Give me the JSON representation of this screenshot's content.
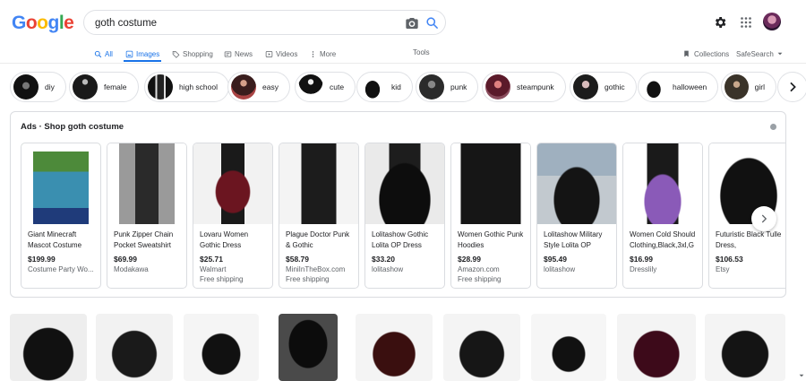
{
  "logo": {
    "letters": [
      "G",
      "o",
      "o",
      "g",
      "l",
      "e"
    ],
    "colors": [
      "#4285f4",
      "#ea4335",
      "#fbbc05",
      "#4285f4",
      "#34a853",
      "#ea4335"
    ]
  },
  "search": {
    "query": "goth costume"
  },
  "tabs": [
    {
      "label": "All",
      "icon": "search-icon"
    },
    {
      "label": "Images",
      "icon": "image-icon",
      "active": true
    },
    {
      "label": "Shopping",
      "icon": "tag-icon"
    },
    {
      "label": "News",
      "icon": "news-icon"
    },
    {
      "label": "Videos",
      "icon": "play-icon"
    },
    {
      "label": "More",
      "icon": "more-icon"
    }
  ],
  "tools_label": "Tools",
  "collections_label": "Collections",
  "safesearch_label": "SafeSearch",
  "chips": [
    "diy",
    "female",
    "high school",
    "easy",
    "cute",
    "kid",
    "punk",
    "steampunk",
    "gothic",
    "halloween",
    "girl"
  ],
  "ads": {
    "title": "Ads · Shop goth costume",
    "products": [
      {
        "name": "Giant Minecraft Mascot Costume",
        "price": "$199.99",
        "store": "Costume Party Wo...",
        "shipping": ""
      },
      {
        "name": "Punk Zipper Chain Pocket Sweatshirt",
        "price": "$69.99",
        "store": "Modakawa",
        "shipping": ""
      },
      {
        "name": "Lovaru Women Gothic Dress",
        "price": "$25.71",
        "store": "Walmart",
        "shipping": "Free shipping"
      },
      {
        "name": "Plague Doctor Punk & Gothic",
        "price": "$58.79",
        "store": "MiniInTheBox.com",
        "shipping": "Free shipping"
      },
      {
        "name": "Lolitashow Gothic Lolita OP Dress",
        "price": "$33.20",
        "store": "lolitashow",
        "shipping": ""
      },
      {
        "name": "Women Gothic Punk Hoodies",
        "price": "$28.99",
        "store": "Amazon.com",
        "shipping": "Free shipping"
      },
      {
        "name": "Lolitashow Military Style Lolita OP",
        "price": "$95.49",
        "store": "lolitashow",
        "shipping": ""
      },
      {
        "name": "Women Cold Should Clothing,Black,3xl,G",
        "price": "$16.99",
        "store": "Dresslily",
        "shipping": ""
      },
      {
        "name": "Futuristic Black Tulle Dress,",
        "price": "$106.53",
        "store": "Etsy",
        "shipping": ""
      }
    ]
  },
  "colors": {
    "accent": "#1a73e8",
    "text": "#202124",
    "muted": "#5f6368",
    "border": "#dadce0"
  }
}
